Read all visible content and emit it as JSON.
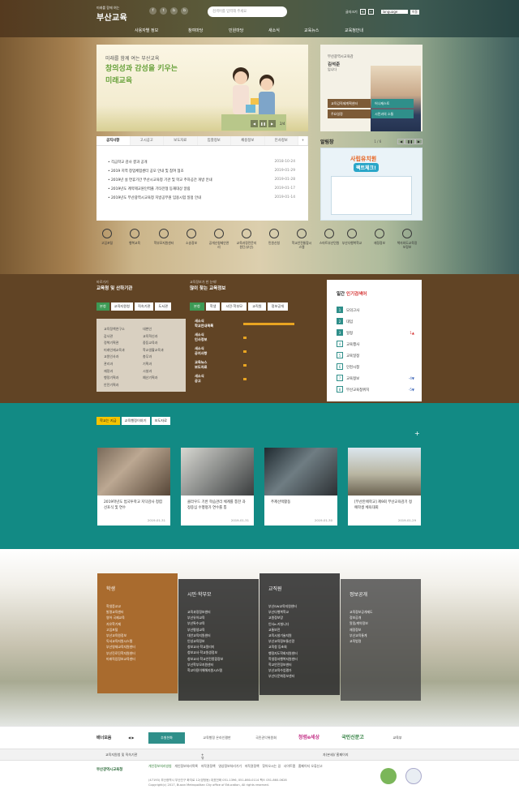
{
  "header": {
    "logo_small": "미래를 함께 여는",
    "logo_big": "부산교육",
    "sns": [
      "f",
      "t",
      "b",
      "b"
    ],
    "search_placeholder": "검색어를 입력해 주세요",
    "zoom_label": "글자크기",
    "language": "language",
    "go": "이동"
  },
  "gnb": [
    "사용자별 정보",
    "참여마당",
    "민원마당",
    "새소식",
    "교육뉴스",
    "교육청안내"
  ],
  "hero": {
    "line1": "미래를 함께 여는 부산교육",
    "line2": "창의성과 감성을 키우는",
    "line3": "미래교육",
    "page": "2/4"
  },
  "profile": {
    "label": "부산광역시교육감",
    "name": "김석준",
    "sub": "입니다",
    "buttons": [
      "교육감직제계획센터",
      "어나제스토",
      "주요일정",
      "시민과의 소통"
    ]
  },
  "notice": {
    "tabs": [
      "공지사항",
      "고시공고",
      "보도자료",
      "입찰정보",
      "채용정보",
      "인사정보"
    ],
    "items": [
      {
        "t": "각급학교 감사 결과 공개",
        "d": "2018-10-24"
      },
      {
        "t": "2019 지역 창업체험센터 공모 안내 및 참여 협조",
        "d": "2019-01-29"
      },
      {
        "t": "2019년 설 연휴기간 부산시교육청 기관 및 학교 주차공간 개방 안내",
        "d": "2019-01-28"
      },
      {
        "t": "2019년도 계약제교원인력풀 기타전형 등재대상 알림",
        "d": "2019-01-17"
      },
      {
        "t": "2019년도 부산광역시교육청 지방공무원 임용시험 일정 안내",
        "d": "2019-01-14"
      }
    ]
  },
  "popup": {
    "title": "알림창",
    "page": "1 / 6",
    "img_title": "사립유치원",
    "img_sub": "팩트체크!"
  },
  "quick": [
    "고입포털",
    "행복교육",
    "학부모지원센터",
    "소송정보",
    "공개신청제안관리",
    "교육과정전문지원단(부산)",
    "민원신청",
    "학교안전통합시스템",
    "스마트부산민원",
    "부산다행복학교",
    "재정정보",
    "책자와도교육정보정보"
  ],
  "org": {
    "small": "바로가기",
    "title": "교육청 및 산하기관",
    "tabs": [
      "본청",
      "교육지원청",
      "직속기관",
      "도서관"
    ],
    "col1": [
      "교육정책연구소",
      "감사관",
      "정책기획관",
      "미래인재교육과",
      "교원인사과",
      "관리과",
      "재정과",
      "행정기획과",
      "안전기획과"
    ],
    "col2": [
      "대변인",
      "교육혁신과",
      "중등교육과",
      "학교생활교육과",
      "총무과",
      "기획과",
      "시설과",
      "예산기획과"
    ]
  },
  "info": {
    "small": "교육정보가 한 눈에!",
    "title": "많이 찾는 교육정보",
    "tabs": [
      "본청",
      "학생",
      "시민·학부모",
      "교직원",
      "정보공개"
    ],
    "rows": [
      {
        "a": "새소식",
        "b": "학교안내목록",
        "v": 0.9
      },
      {
        "a": "새소식",
        "b": "인사정보",
        "v": 0.06
      },
      {
        "a": "새소식",
        "b": "공지사항",
        "v": 0.06
      },
      {
        "a": "교육뉴스",
        "b": "보도자료",
        "v": 0.06
      },
      {
        "a": "새소식",
        "b": "공고",
        "v": 0.06
      }
    ]
  },
  "rank": {
    "title_a": "일간 ",
    "title_b": "인기검색어",
    "items": [
      {
        "n": "1",
        "w": "모의고사",
        "c": ""
      },
      {
        "n": "2",
        "w": "대입",
        "c": ""
      },
      {
        "n": "3",
        "w": "일정",
        "c": "1▲"
      },
      {
        "n": "4",
        "w": "교육행사",
        "c": ""
      },
      {
        "n": "5",
        "w": "교육일정",
        "c": ""
      },
      {
        "n": "6",
        "w": "인천시청",
        "c": ""
      },
      {
        "n": "7",
        "w": "교육정보",
        "c": "-4▼"
      },
      {
        "n": "8",
        "w": "부산교육청위치",
        "c": "-5▼"
      }
    ]
  },
  "news": {
    "tabs": [
      "학교는 지금",
      "교육행정이야기",
      "보도자료"
    ],
    "plus": "+",
    "cards": [
      {
        "t": "2019학년도 범국투학교 지닥감사 청렴 선포식 및 연수",
        "d": "2019-01-31"
      },
      {
        "t": "클라우드 기반 학습관리 체계를 통한 과정중심 수행평가 연수를 통",
        "d": "2019-01-31"
      },
      {
        "t": "주제선택활동",
        "d": "2019-01-30"
      },
      {
        "t": "[부산만에학교] 제9회 부산교육감기 정예학생 체육대회",
        "d": "2019-01-29"
      }
    ]
  },
  "links": [
    {
      "h": "학생",
      "l": [
        "학생증교교",
        "발명교육센터",
        "영어 국제교육",
        "자유학기제",
        "고입포털",
        "부산교육원정보",
        "독서교육지원시스템",
        "부산영재교육지원센터",
        "부산진로진학지원센터",
        "미래직업정보교육센터"
      ]
    },
    {
      "h": "시민·학부모",
      "l": [
        "교육과정정보센터",
        "부산유아교육",
        "부산특수교육",
        "부산평생교육",
        "대안교육지원센터",
        "인성교육정보",
        "청보교사·학교알리미",
        "청보교사·학교원생정보",
        "청보교사·학교안전종합정보",
        "부산학부모지원센터",
        "학교이용이해해지원시스템"
      ]
    },
    {
      "h": "교직원",
      "l": [
        "부산SW교육지원센터",
        "부산다행복학교",
        "교원정보망",
        "인사e-카칠니다",
        "교통보전",
        "교육시설기술지원",
        "부산교육정보통신망",
        "교육청 등초회",
        "행정지도학회지원센터",
        "학생정서행복지원센터",
        "학교안전정보센터",
        "부산교육수업평가",
        "부산다문화정보센터"
      ]
    },
    {
      "h": "정보공개",
      "l": [
        "교육정보공개제도",
        "정보공개",
        "알림/계약정보",
        "재정정보",
        "부산교육통계",
        "교육법령"
      ]
    }
  ],
  "banner": {
    "label": "배너모음",
    "items": [
      "추칠친화",
      "교육행정 온라인평판",
      "국민권익위원회",
      "청렴e세상",
      "국민신문고",
      "교육부"
    ]
  },
  "selects": [
    "교육지원청 및 직속기관",
    "유관기관",
    "자(본세)/ 홈페이지"
  ],
  "footer": {
    "logo": "부산광역시교육청",
    "links": [
      "개인정보처리방침",
      "개인정보처리목록",
      "저작권정책",
      "영상정보처리기기",
      "저작권정책",
      "찾아오시는 길",
      "사이트맵",
      "홈페이지 오류신고"
    ],
    "address": "(47193) 부산광역시 부산진구 화지로 12(양정동) 대표전화 051-1396, 051-860-0114 팩스 051-860-0628",
    "copy": "Copyright(c) 2017, Busan Metropolitan City office of Education, All rights reserved."
  }
}
